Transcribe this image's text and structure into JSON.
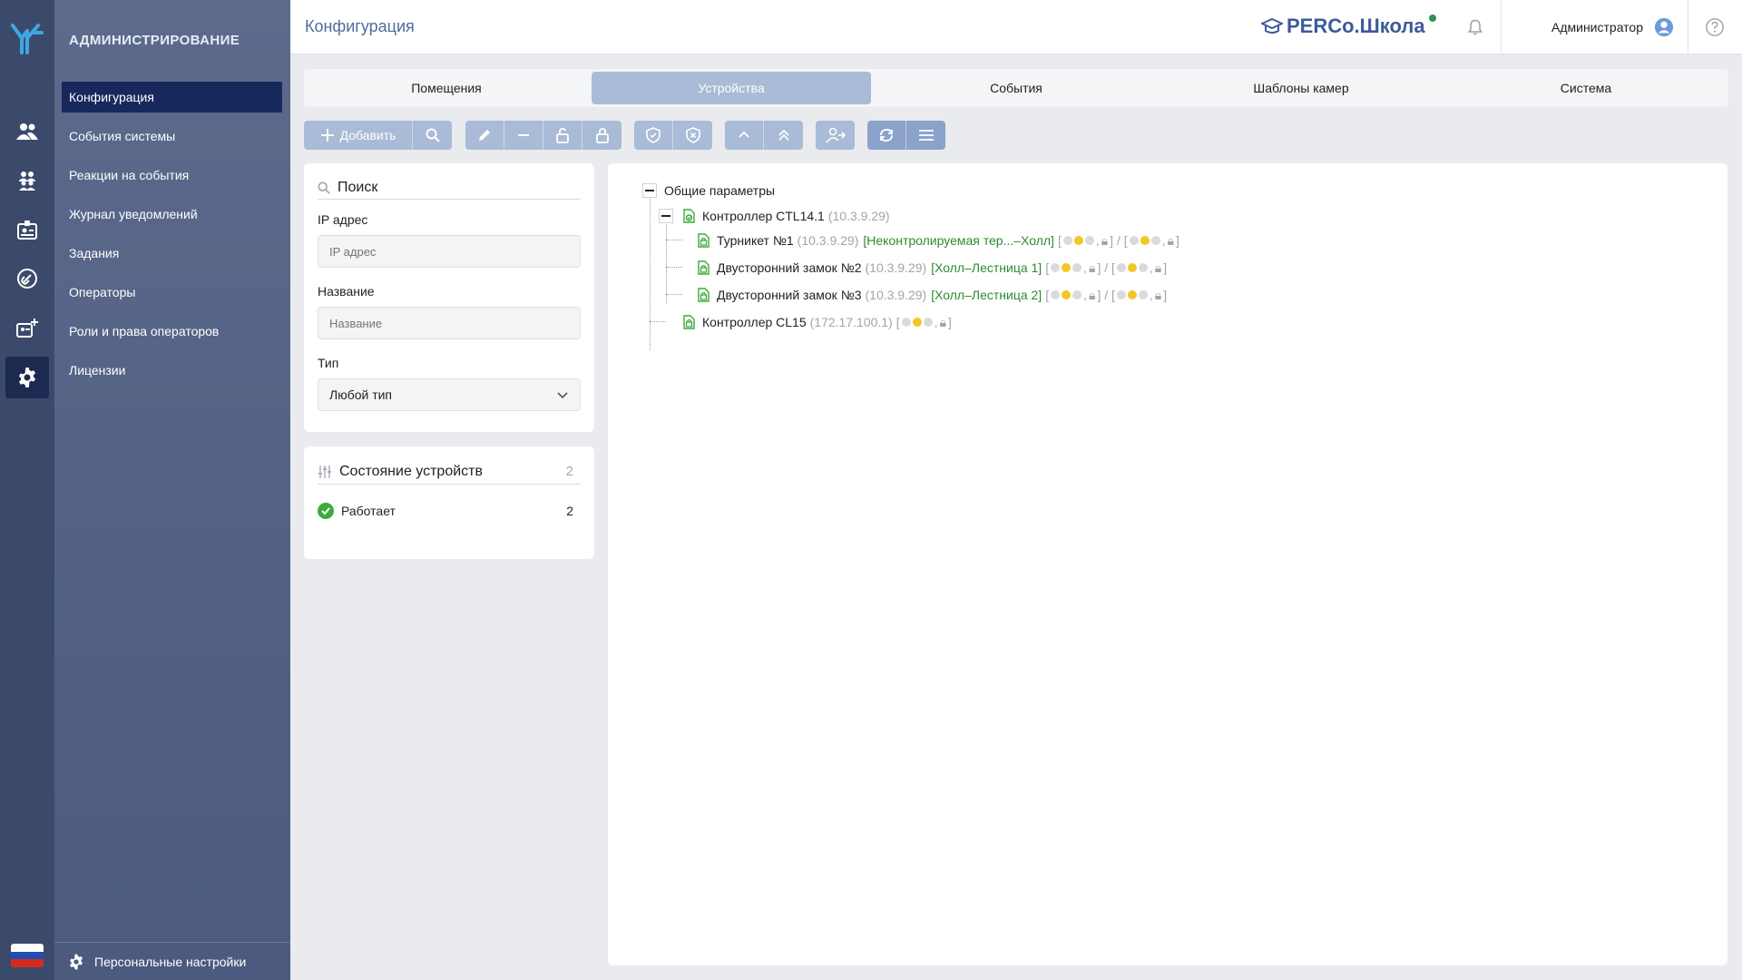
{
  "nav": {
    "section_title": "АДМИНИСТРИРОВАНИЕ",
    "items": [
      {
        "label": "Конфигурация"
      },
      {
        "label": "События системы"
      },
      {
        "label": "Реакции на события"
      },
      {
        "label": "Журнал уведомлений"
      },
      {
        "label": "Задания"
      },
      {
        "label": "Операторы"
      },
      {
        "label": "Роли и права операторов"
      },
      {
        "label": "Лицензии"
      }
    ],
    "personal_settings": "Персональные настройки"
  },
  "header": {
    "title": "Конфигурация",
    "brand": "PERCo.Школа",
    "user": "Администратор"
  },
  "tabs": [
    "Помещения",
    "Устройства",
    "События",
    "Шаблоны камер",
    "Система"
  ],
  "toolbar": {
    "add_label": "Добавить"
  },
  "filters": {
    "search_label": "Поиск",
    "ip_label": "IP адрес",
    "ip_placeholder": "IP адрес",
    "name_label": "Название",
    "name_placeholder": "Название",
    "type_label": "Тип",
    "type_value": "Любой тип"
  },
  "status": {
    "title": "Состояние устройств",
    "count": "2",
    "rows": [
      {
        "label": "Работает",
        "count": "2"
      }
    ]
  },
  "tree": {
    "root": "Общие параметры",
    "controller1": {
      "name": "Контроллер CTL14.1",
      "ip": "(10.3.9.29)"
    },
    "devices": [
      {
        "name": "Турникет №1",
        "ip": "(10.3.9.29)",
        "zone": "[Неконтролируемая тер...–Холл]"
      },
      {
        "name": "Двусторонний замок №2",
        "ip": "(10.3.9.29)",
        "zone": "[Холл–Лестница 1]"
      },
      {
        "name": "Двусторонний замок №3",
        "ip": "(10.3.9.29)",
        "zone": "[Холл–Лестница 2]"
      }
    ],
    "controller2": {
      "name": "Контроллер CL15",
      "ip": "(172.17.100.1)"
    }
  },
  "colors": {
    "rail": "#3b4a6b",
    "nav_active": "#16285c",
    "tab_active": "#a9bbd6",
    "zone_text": "#2e8b2e",
    "status_ok": "#3caa3c",
    "indicator_yellow": "#f3c623"
  }
}
